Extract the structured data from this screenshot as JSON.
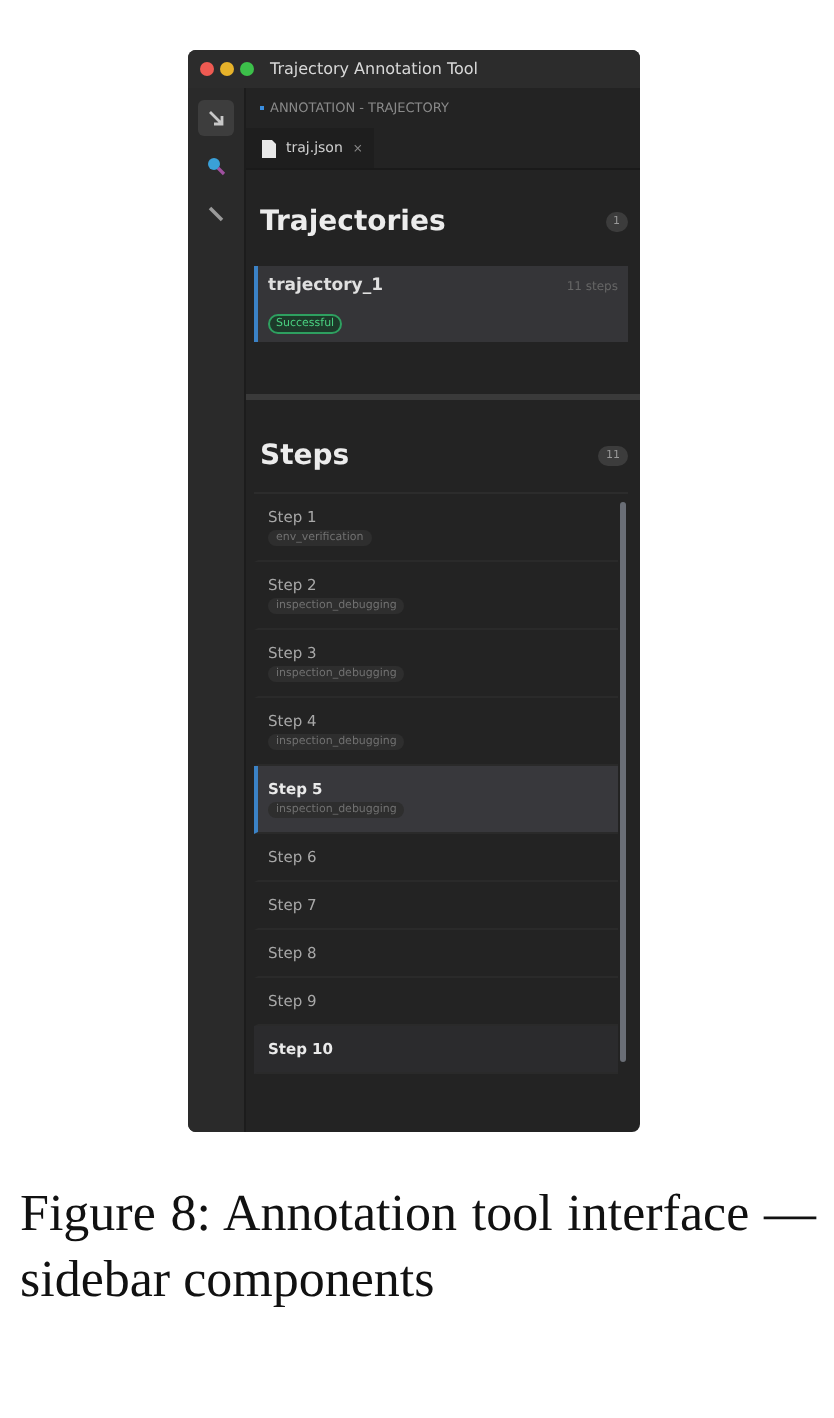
{
  "window": {
    "title": "Trajectory Annotation Tool"
  },
  "activity_bar": [
    {
      "kind": "arrow",
      "selected": true
    },
    {
      "kind": "search",
      "selected": false
    },
    {
      "kind": "pen",
      "selected": false
    }
  ],
  "breadcrumb": "ANNOTATION - TRAJECTORY",
  "tabs": [
    {
      "label": "traj.json",
      "close": "×",
      "selected": true
    }
  ],
  "trajectories": {
    "title": "Trajectories",
    "count": "1",
    "items": [
      {
        "name": "trajectory_1",
        "steps": "11 steps",
        "status": "Successful",
        "selected": true
      }
    ]
  },
  "steps": {
    "title": "Steps",
    "count": "11",
    "items": [
      {
        "label": "Step 1",
        "tag": "env_verification",
        "selected": false,
        "hovered": false
      },
      {
        "label": "Step 2",
        "tag": "inspection_debugging",
        "selected": false,
        "hovered": false
      },
      {
        "label": "Step 3",
        "tag": "inspection_debugging",
        "selected": false,
        "hovered": false
      },
      {
        "label": "Step 4",
        "tag": "inspection_debugging",
        "selected": false,
        "hovered": false
      },
      {
        "label": "Step 5",
        "tag": "inspection_debugging",
        "selected": true,
        "hovered": false
      },
      {
        "label": "Step 6",
        "selected": false,
        "hovered": false
      },
      {
        "label": "Step 7",
        "selected": false,
        "hovered": false
      },
      {
        "label": "Step 8",
        "selected": false,
        "hovered": false
      },
      {
        "label": "Step 9",
        "selected": false,
        "hovered": false
      },
      {
        "label": "Step 10",
        "selected": false,
        "hovered": true
      }
    ]
  },
  "caption": "Figure 8:  Annotation tool interface — sidebar components"
}
